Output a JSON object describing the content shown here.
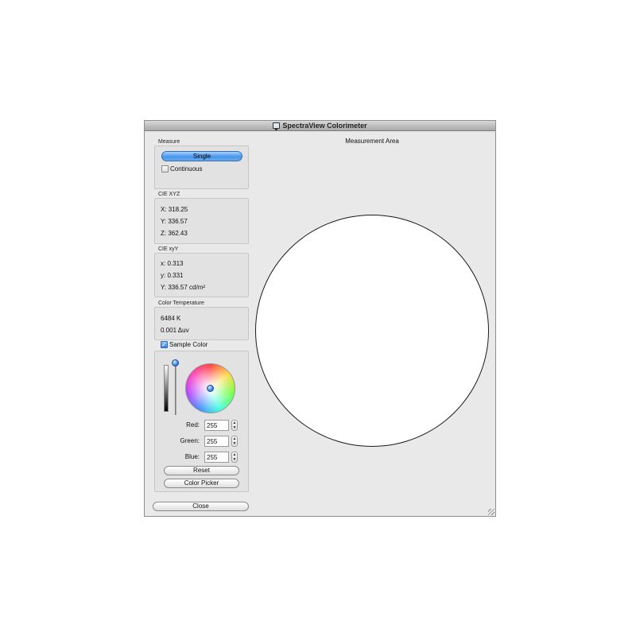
{
  "window": {
    "title": "SpectraView Colorimeter"
  },
  "measure": {
    "label": "Measure",
    "single_button": "Single",
    "continuous_label": "Continuous",
    "continuous_checked": false
  },
  "cie_xyz": {
    "label": "CIE XYZ",
    "x": "X:  318.25",
    "y": "Y:  336.57",
    "z": "Z:  362.43"
  },
  "cie_xyy": {
    "label": "CIE xyY",
    "x": "x:  0.313",
    "y": "y:  0.331",
    "Y": "Y:  336.57 cd/m²"
  },
  "color_temperature": {
    "label": "Color Temperature",
    "kelvin": "6484 K",
    "delta_uv": "0.001 Δuv"
  },
  "sample_color": {
    "label": "Sample Color",
    "checked": true,
    "red_label": "Red:",
    "red_value": "255",
    "green_label": "Green:",
    "green_value": "255",
    "blue_label": "Blue:",
    "blue_value": "255",
    "reset_button": "Reset",
    "color_picker_button": "Color Picker"
  },
  "close_button": "Close",
  "measurement_area": {
    "title": "Measurement Area"
  },
  "colors": {
    "accent": "#4a94e8",
    "window_bg": "#e9e9e9",
    "sample_fill": "#ffffff"
  },
  "icons": [
    "display-icon",
    "checkmark-icon",
    "stepper-icon",
    "resize-grip-icon"
  ]
}
